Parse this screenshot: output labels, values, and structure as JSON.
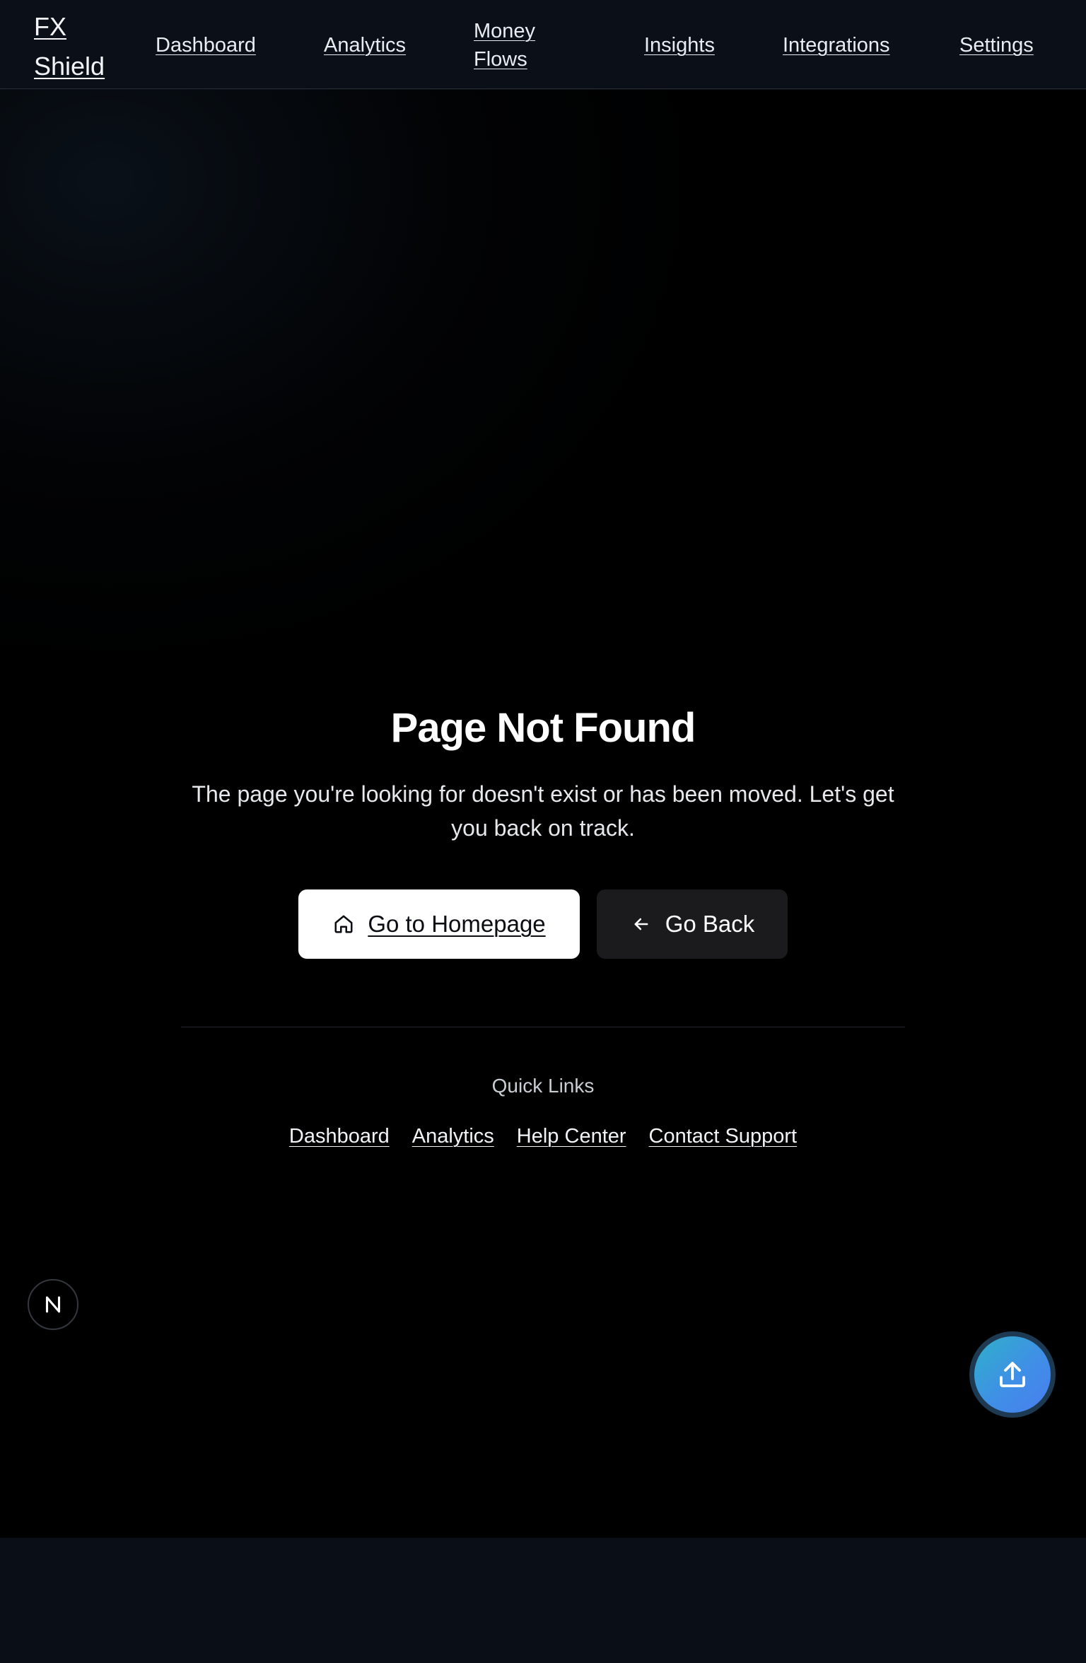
{
  "nav": {
    "brand": "FX Shield",
    "links": [
      "Dashboard",
      "Analytics",
      "Money Flows",
      "Insights",
      "Integrations",
      "Settings"
    ]
  },
  "main": {
    "title": "Page Not Found",
    "description": "The page you're looking for doesn't exist or has been moved. Let's get you back on track.",
    "primary_button": {
      "label": "Go to Homepage",
      "icon": "home-icon"
    },
    "secondary_button": {
      "label": "Go Back",
      "icon": "arrow-left-icon"
    },
    "quick_links": {
      "title": "Quick Links",
      "links": [
        "Dashboard",
        "Analytics",
        "Help Center",
        "Contact Support"
      ]
    }
  },
  "badge": {
    "letter": "N"
  },
  "fab": {
    "icon": "upload-icon"
  },
  "colors": {
    "nav_bg": "#0b0f18",
    "page_bg": "#000000",
    "primary_button_bg": "#ffffff",
    "secondary_button_bg": "#1b1b1d",
    "fab_gradient_start": "#2fb0c9",
    "fab_gradient_end": "#4a7ef0"
  }
}
